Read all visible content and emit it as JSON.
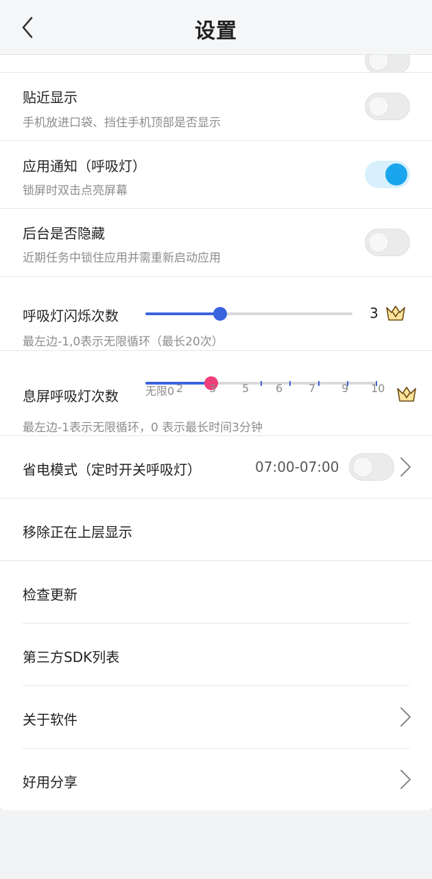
{
  "header": {
    "title": "设置"
  },
  "settings": {
    "proximity": {
      "title": "贴近显示",
      "subtitle": "手机放进口袋、挡住手机顶部是否显示",
      "enabled": false
    },
    "app_notify": {
      "title": "应用通知（呼吸灯）",
      "subtitle": "锁屏时双击点亮屏幕",
      "enabled": true
    },
    "hide_bg": {
      "title": "后台是否隐藏",
      "subtitle": "近期任务中锁住应用并需重新启动应用",
      "enabled": false
    },
    "blink_count": {
      "title": "呼吸灯闪烁次数",
      "subtitle": "最左边-1,0表示无限循环（最长20次）",
      "value_label": "3",
      "level": 0.36,
      "fill_color": "#3a63e0",
      "thumb_color": "#3a63e0"
    },
    "screen_off_count": {
      "title": "息屏呼吸灯次数",
      "subtitle": "最左边-1表示无限循环，0 表示最长时间3分钟",
      "ticks": [
        "无限",
        "0",
        "2",
        "3",
        "5",
        "6",
        "7",
        "9",
        "10"
      ],
      "selected_index": 3,
      "fill_color": "#3a63e0",
      "thumb_color": "#ee3f7a"
    },
    "power_save": {
      "title": "省电模式（定时开关呼吸灯）",
      "time": "07:00-07:00",
      "enabled": false
    },
    "remove_overlay": {
      "title": "移除正在上层显示"
    },
    "check_update": {
      "title": "检查更新"
    },
    "sdk_list": {
      "title": "第三方SDK列表"
    },
    "about": {
      "title": "关于软件"
    },
    "share": {
      "title": "好用分享"
    }
  }
}
